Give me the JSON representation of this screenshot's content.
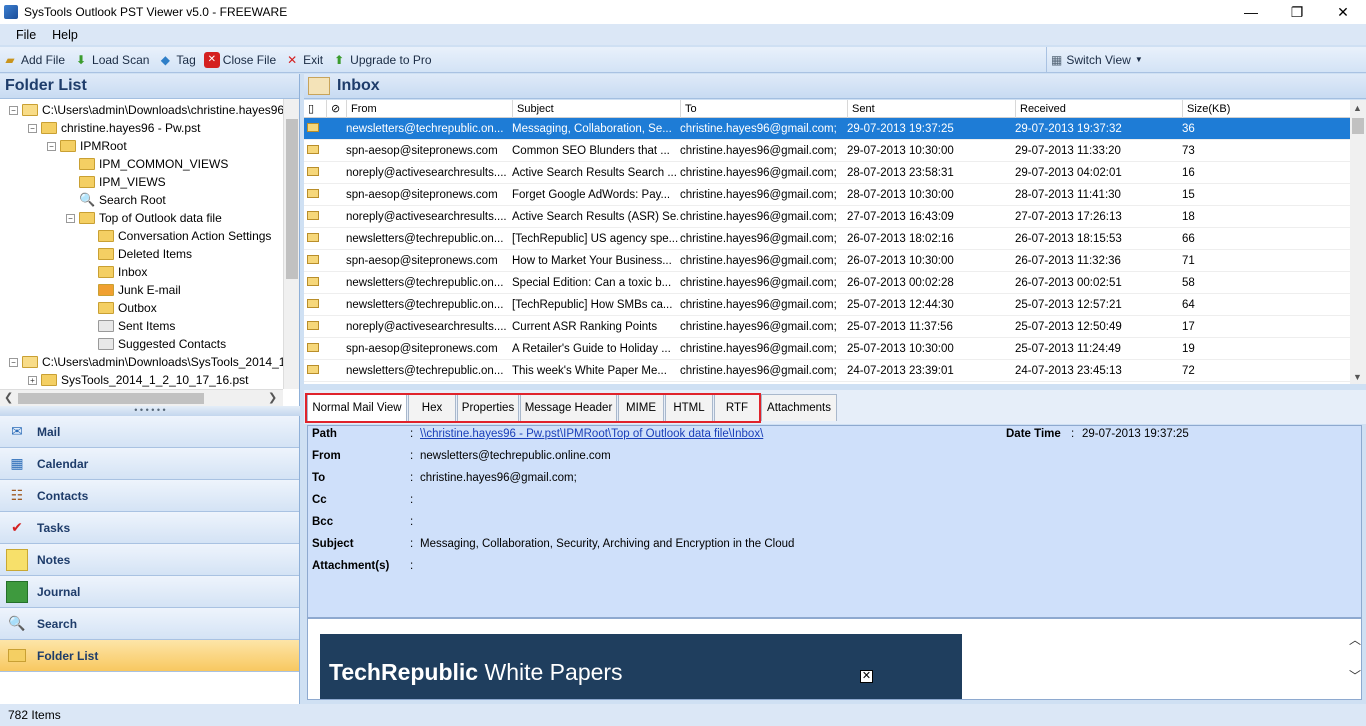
{
  "window": {
    "title": "SysTools Outlook PST Viewer v5.0 - FREEWARE",
    "minimize": "—",
    "maximize": "❐",
    "close": "✕"
  },
  "menu": [
    "File",
    "Help"
  ],
  "toolbar": {
    "add_file": "Add File",
    "load_scan": "Load Scan",
    "tag": "Tag",
    "close_file": "Close File",
    "exit": "Exit",
    "upgrade": "Upgrade to Pro",
    "switch_view": "Switch View"
  },
  "folder_list": {
    "title": "Folder List",
    "nodes": [
      {
        "label": "C:\\Users\\admin\\Downloads\\christine.hayes96 - Pw.pst",
        "toggle": "−"
      },
      {
        "label": "christine.hayes96 - Pw.pst",
        "toggle": "−"
      },
      {
        "label": "IPMRoot",
        "toggle": "−"
      },
      {
        "label": "IPM_COMMON_VIEWS",
        "toggle": ""
      },
      {
        "label": "IPM_VIEWS",
        "toggle": ""
      },
      {
        "label": "Search Root",
        "toggle": ""
      },
      {
        "label": "Top of Outlook data file",
        "toggle": "−"
      },
      {
        "label": "Conversation Action Settings",
        "toggle": ""
      },
      {
        "label": "Deleted Items",
        "toggle": ""
      },
      {
        "label": "Inbox",
        "toggle": ""
      },
      {
        "label": "Junk E-mail",
        "toggle": ""
      },
      {
        "label": "Outbox",
        "toggle": ""
      },
      {
        "label": "Sent Items",
        "toggle": ""
      },
      {
        "label": "Suggested Contacts",
        "toggle": ""
      },
      {
        "label": "C:\\Users\\admin\\Downloads\\SysTools_2014_1_2_10_17_16.pst",
        "toggle": "−"
      },
      {
        "label": "SysTools_2014_1_2_10_17_16.pst",
        "toggle": "+"
      }
    ]
  },
  "nav": [
    "Mail",
    "Calendar",
    "Contacts",
    "Tasks",
    "Notes",
    "Journal",
    "Search",
    "Folder List"
  ],
  "inbox": {
    "title": "Inbox",
    "columns": [
      "From",
      "Subject",
      "To",
      "Sent",
      "Received",
      "Size(KB)"
    ],
    "rows": [
      [
        "newsletters@techrepublic.on...",
        "Messaging, Collaboration, Se...",
        "christine.hayes96@gmail.com;",
        "29-07-2013 19:37:25",
        "29-07-2013 19:37:32",
        "36"
      ],
      [
        "spn-aesop@sitepronews.com",
        "Common SEO Blunders that ...",
        "christine.hayes96@gmail.com;",
        "29-07-2013 10:30:00",
        "29-07-2013 11:33:20",
        "73"
      ],
      [
        "noreply@activesearchresults....",
        "Active Search Results Search ...",
        "christine.hayes96@gmail.com;",
        "28-07-2013 23:58:31",
        "29-07-2013 04:02:01",
        "16"
      ],
      [
        "spn-aesop@sitepronews.com",
        "Forget Google AdWords: Pay...",
        "christine.hayes96@gmail.com;",
        "28-07-2013 10:30:00",
        "28-07-2013 11:41:30",
        "15"
      ],
      [
        "noreply@activesearchresults....",
        "Active Search Results (ASR) Se...",
        "christine.hayes96@gmail.com;",
        "27-07-2013 16:43:09",
        "27-07-2013 17:26:13",
        "18"
      ],
      [
        "newsletters@techrepublic.on...",
        "[TechRepublic] US agency spe...",
        "christine.hayes96@gmail.com;",
        "26-07-2013 18:02:16",
        "26-07-2013 18:15:53",
        "66"
      ],
      [
        "spn-aesop@sitepronews.com",
        "How to Market Your Business...",
        "christine.hayes96@gmail.com;",
        "26-07-2013 10:30:00",
        "26-07-2013 11:32:36",
        "71"
      ],
      [
        "newsletters@techrepublic.on...",
        "Special Edition: Can a toxic b...",
        "christine.hayes96@gmail.com;",
        "26-07-2013 00:02:28",
        "26-07-2013 00:02:51",
        "58"
      ],
      [
        "newsletters@techrepublic.on...",
        "[TechRepublic] How SMBs ca...",
        "christine.hayes96@gmail.com;",
        "25-07-2013 12:44:30",
        "25-07-2013 12:57:21",
        "64"
      ],
      [
        "noreply@activesearchresults....",
        "Current ASR Ranking Points",
        "christine.hayes96@gmail.com;",
        "25-07-2013 11:37:56",
        "25-07-2013 12:50:49",
        "17"
      ],
      [
        "spn-aesop@sitepronews.com",
        "A Retailer's Guide to Holiday ...",
        "christine.hayes96@gmail.com;",
        "25-07-2013 10:30:00",
        "25-07-2013 11:24:49",
        "19"
      ],
      [
        "newsletters@techrepublic.on...",
        "This week's White Paper Me...",
        "christine.hayes96@gmail.com;",
        "24-07-2013 23:39:01",
        "24-07-2013 23:45:13",
        "72"
      ]
    ]
  },
  "tabs": [
    "Normal Mail View",
    "Hex",
    "Properties",
    "Message Header",
    "MIME",
    "HTML",
    "RTF",
    "Attachments"
  ],
  "details": {
    "path_label": "Path",
    "path_value": "\\\\christine.hayes96 - Pw.pst\\IPMRoot\\Top of Outlook data file\\Inbox\\",
    "from_label": "From",
    "from_value": "newsletters@techrepublic.online.com",
    "to_label": "To",
    "to_value": "christine.hayes96@gmail.com;",
    "cc_label": "Cc",
    "bcc_label": "Bcc",
    "subject_label": "Subject",
    "subject_value": "Messaging, Collaboration, Security, Archiving and Encryption in the Cloud",
    "attachments_label": "Attachment(s)",
    "colon": ":",
    "date_label": "Date Time",
    "date_value": "29-07-2013 19:37:25"
  },
  "preview": {
    "brand": "TechRepublic",
    "rest": " White Papers",
    "close": "✕"
  },
  "status": {
    "items": "782 Items"
  },
  "colors": {
    "selection": "#1e7cd6",
    "highlight": "#e0232b",
    "panel": "#cfe0fa"
  }
}
